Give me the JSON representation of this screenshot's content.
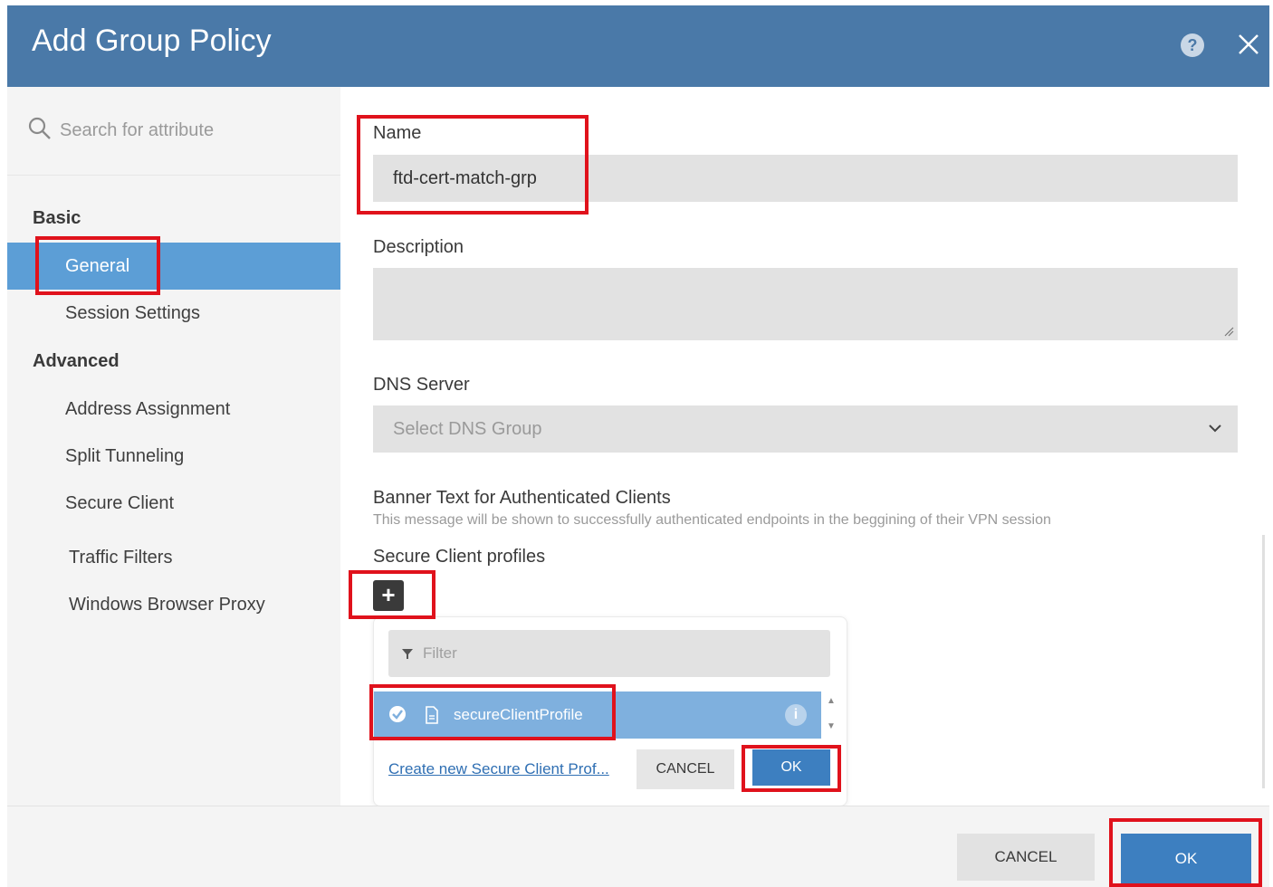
{
  "dialog": {
    "title": "Add Group Policy",
    "help_icon": "help-circle-icon",
    "close_icon": "close-icon"
  },
  "sidebar": {
    "search_placeholder": "Search for attribute",
    "sections": [
      {
        "title": "Basic",
        "items": [
          "General",
          "Session Settings"
        ]
      },
      {
        "title": "Advanced",
        "items": [
          "Address Assignment",
          "Split Tunneling",
          "Secure Client",
          "Traffic Filters",
          "Windows Browser Proxy"
        ]
      }
    ],
    "active_item": "General"
  },
  "form": {
    "name_label": "Name",
    "name_value": "ftd-cert-match-grp",
    "description_label": "Description",
    "description_value": "",
    "dns_label": "DNS Server",
    "dns_placeholder": "Select DNS Group",
    "banner_label": "Banner Text for Authenticated Clients",
    "banner_hint": "This message will be shown to successfully authenticated endpoints in the beggining of their VPN session",
    "profiles_label": "Secure Client profiles",
    "add_symbol": "+"
  },
  "popup": {
    "filter_placeholder": "Filter",
    "profile_name": "secureClientProfile",
    "info_symbol": "i",
    "create_link": "Create new Secure Client Prof...",
    "cancel_label": "CANCEL",
    "ok_label": "OK"
  },
  "footer": {
    "cancel_label": "CANCEL",
    "ok_label": "OK"
  },
  "colors": {
    "header": "#4a79a8",
    "active_nav": "#5c9ed6",
    "selected_row": "#7fb0de",
    "primary_button": "#3d7fc0",
    "highlight": "#e0121c"
  }
}
